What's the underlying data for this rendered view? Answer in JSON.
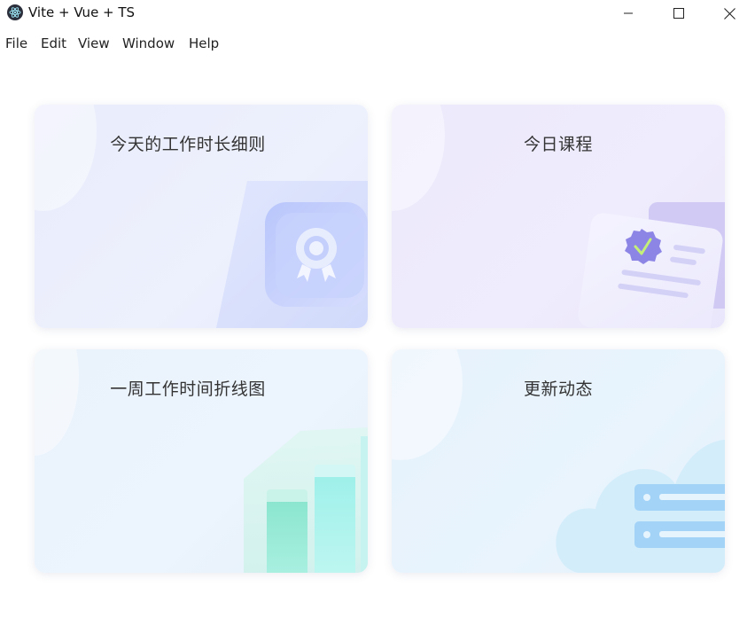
{
  "window": {
    "title": "Vite + Vue + TS",
    "controls": [
      "minimize",
      "maximize",
      "close"
    ]
  },
  "menu": {
    "items": [
      "File",
      "Edit",
      "View",
      "Window",
      "Help"
    ]
  },
  "cards": [
    {
      "title": "今天的工作时长细则",
      "icon": "award-medal-icon",
      "accent": "#7b8ef5"
    },
    {
      "title": "今日课程",
      "icon": "certificate-document-icon",
      "accent": "#8a7fe8"
    },
    {
      "title": "一周工作时间折线图",
      "icon": "bar-chart-icon",
      "accent": "#5dd9c1"
    },
    {
      "title": "更新动态",
      "icon": "cloud-server-icon",
      "accent": "#6ec4f2"
    }
  ]
}
